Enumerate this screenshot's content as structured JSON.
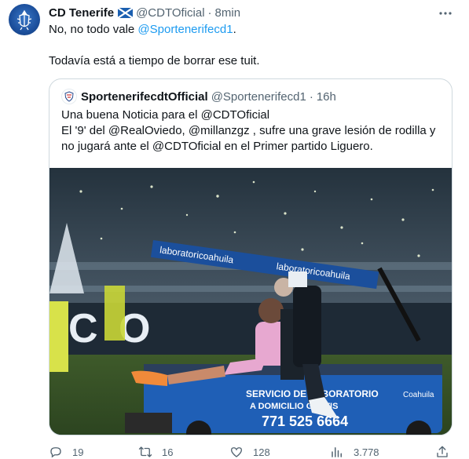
{
  "tweet": {
    "display_name": "CD Tenerife",
    "handle": "@CDTOficial",
    "separator": "·",
    "time": "8min",
    "text_line1_prefix": "No, no todo vale ",
    "text_line1_mention": "@Sportenerifecd1",
    "text_line1_suffix": ".",
    "text_line2": "Todavía está a tiempo de borrar ese tuit."
  },
  "quote": {
    "display_name": "SportenerifecdtOfficial",
    "handle": "@Sportenerifecd1",
    "separator": "·",
    "time": "16h",
    "line1": "Una buena Noticia para el @CDTOficial",
    "line2": "El '9' del @RealOviedo, @millanzgz , sufre una grave lesión de rodilla y",
    "line3": "no jugará ante el @CDTOficial en el Primer partido Liguero.",
    "media": {
      "banner_text": "laboratoricoahuila",
      "cart_text_1": "SERVICIO DE LABORATORIO",
      "cart_text_2": "A DOMICILIO GRATIS",
      "cart_phone": "771 525 6664",
      "cart_brand": "Coahuila"
    }
  },
  "actions": {
    "replies": "19",
    "retweets": "16",
    "likes": "128",
    "views": "3.778"
  },
  "icons": {
    "more": "more-icon",
    "reply": "reply-icon",
    "retweet": "retweet-icon",
    "like": "like-icon",
    "views": "views-icon",
    "share": "share-icon"
  },
  "colors": {
    "link": "#1d9bf0",
    "text": "#0f1419",
    "secondary": "#536471",
    "border": "#cfd9de"
  }
}
